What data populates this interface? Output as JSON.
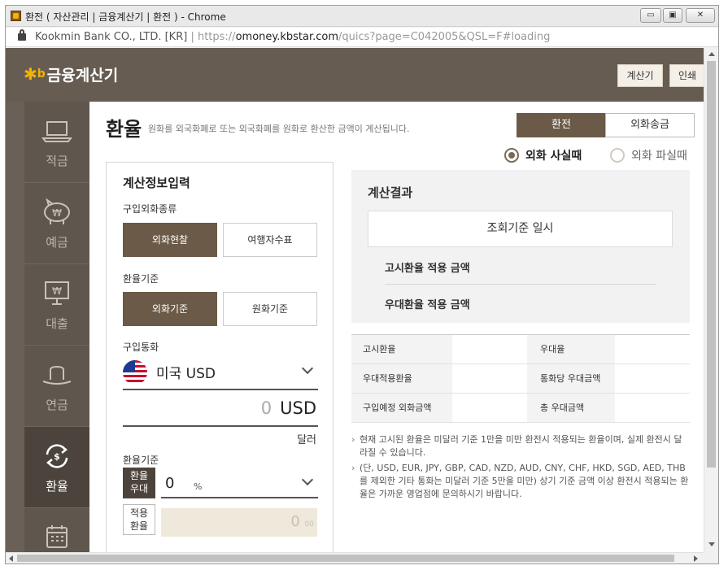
{
  "window": {
    "title": "환전 ( 자산관리 | 금융계산기 | 환전 ) - Chrome",
    "min_icon": "minimize-icon",
    "max_icon": "maximize-icon",
    "close_icon": "close-icon"
  },
  "address": {
    "site": "Kookmin Bank CO., LTD. [KR]",
    "sep": "|",
    "scheme": "https://",
    "host": "omoney.kbstar.com",
    "path": "/quics?page=C042005&QSL=F#loading"
  },
  "header": {
    "logo_star": "✱",
    "logo_kb": "b",
    "logo_text": "금융계산기",
    "btn_calc": "계산기",
    "btn_print": "인쇄"
  },
  "nav": {
    "items": [
      {
        "label": "적금",
        "icon": "laptop-icon"
      },
      {
        "label": "예금",
        "icon": "piggy-bank-icon"
      },
      {
        "label": "대출",
        "icon": "monitor-won-icon"
      },
      {
        "label": "연금",
        "icon": "hat-icon"
      },
      {
        "label": "환율",
        "icon": "exchange-icon",
        "active": true
      },
      {
        "label": "",
        "icon": "calendar-icon"
      }
    ]
  },
  "main": {
    "title": "환율",
    "desc": "원화를 외국화폐로 또는 외국화폐를 원화로 환산한 금액이 계산됩니다.",
    "tab_exchange": "환전",
    "tab_remit": "외화송금",
    "radio_buy": "외화 사실때",
    "radio_sell": "외화 파실때"
  },
  "form": {
    "heading": "계산정보입력",
    "type_label": "구입외화종류",
    "type_cash": "외화현찰",
    "type_check": "여행자수표",
    "basis_label": "환율기준",
    "basis_foreign": "외화기준",
    "basis_won": "원화기준",
    "currency_label": "구입통화",
    "currency_value": "미국 USD",
    "amount_value": "0",
    "amount_unit": "USD",
    "amount_word": "달러",
    "rate_label": "환율기준",
    "pref_rate_btn_line1": "환율",
    "pref_rate_btn_line2": "우대",
    "pref_value": "0",
    "pref_unit": "%",
    "applied_btn_line1": "적용",
    "applied_btn_line2": "환율",
    "applied_value": "0",
    "applied_decimal": "00"
  },
  "result": {
    "heading": "계산결과",
    "query_time": "조회기준 일시",
    "notice_amount": "고시환율 적용 금액",
    "pref_amount": "우대환율 적용 금액"
  },
  "table": {
    "rows": [
      {
        "left": "고시환율",
        "right": "우대율"
      },
      {
        "left": "우대적용환율",
        "right": "통화당 우대금액"
      },
      {
        "left": "구입예정 외화금액",
        "right": "총 우대금액"
      }
    ]
  },
  "notes": [
    "현재 고시된 환율은 미달러 기준 1만을 미만 환전시 적용되는 환율이며, 실제 환전시 달라질 수 있습니다.",
    "(단, USD, EUR, JPY, GBP, CAD, NZD, AUD, CNY, CHF, HKD, SGD, AED, THB를 제외한 기타 통화는 미달러 기준 5만을 미만) 상기 기준 금액 이상 환전시 적용되는 환율은 가까운 영업점에 문의하시기 바랍니다."
  ],
  "colors": {
    "brand_brown": "#665c52",
    "active_brown": "#6b5a47",
    "kb_yellow": "#f2b400"
  }
}
